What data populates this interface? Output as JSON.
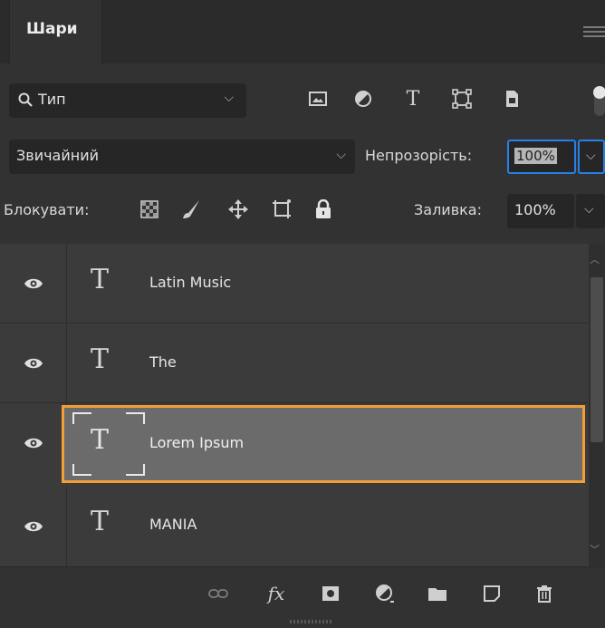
{
  "panel": {
    "tab_label": "Шари",
    "menu_icon": "hamburger-menu-icon"
  },
  "filter": {
    "type_label": "Тип",
    "icons": [
      "image-filter-icon",
      "adjustment-filter-icon",
      "text-filter-icon",
      "shape-filter-icon",
      "smart-object-filter-icon"
    ]
  },
  "blend": {
    "mode": "Звичайний",
    "opacity_label": "Непрозорість:",
    "opacity_value": "100%"
  },
  "lock": {
    "label": "Блокувати:",
    "fill_label": "Заливка:",
    "fill_value": "100%"
  },
  "layers": [
    {
      "name": "Latin Music",
      "kind": "T",
      "visible": true,
      "selected": false
    },
    {
      "name": "The",
      "kind": "T",
      "visible": true,
      "selected": false
    },
    {
      "name": "Lorem Ipsum",
      "kind": "T",
      "visible": true,
      "selected": true
    },
    {
      "name": "MANIA",
      "kind": "T",
      "visible": true,
      "selected": false
    }
  ],
  "bottom_icons": [
    "link-layers-icon",
    "fx-icon",
    "add-mask-icon",
    "adjustment-layer-icon",
    "new-group-icon",
    "new-layer-icon",
    "delete-icon"
  ],
  "colors": {
    "selection_border": "#f29e38",
    "focus_border": "#2680eb",
    "panel_bg": "#323232"
  }
}
